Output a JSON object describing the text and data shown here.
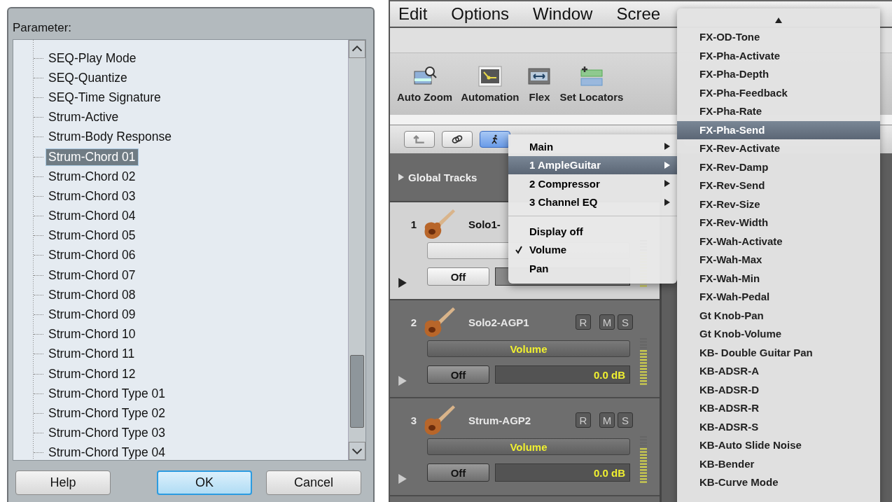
{
  "dialog": {
    "label": "Parameter:",
    "items": [
      {
        "text": "SEQ-Play Mode",
        "selected": false
      },
      {
        "text": "SEQ-Quantize",
        "selected": false
      },
      {
        "text": "SEQ-Time Signature",
        "selected": false
      },
      {
        "text": "Strum-Active",
        "selected": false
      },
      {
        "text": "Strum-Body Response",
        "selected": false
      },
      {
        "text": "Strum-Chord 01",
        "selected": true
      },
      {
        "text": "Strum-Chord 02",
        "selected": false
      },
      {
        "text": "Strum-Chord 03",
        "selected": false
      },
      {
        "text": "Strum-Chord 04",
        "selected": false
      },
      {
        "text": "Strum-Chord 05",
        "selected": false
      },
      {
        "text": "Strum-Chord 06",
        "selected": false
      },
      {
        "text": "Strum-Chord 07",
        "selected": false
      },
      {
        "text": "Strum-Chord 08",
        "selected": false
      },
      {
        "text": "Strum-Chord 09",
        "selected": false
      },
      {
        "text": "Strum-Chord 10",
        "selected": false
      },
      {
        "text": "Strum-Chord 11",
        "selected": false
      },
      {
        "text": "Strum-Chord 12",
        "selected": false
      },
      {
        "text": "Strum-Chord Type 01",
        "selected": false
      },
      {
        "text": "Strum-Chord Type 02",
        "selected": false
      },
      {
        "text": "Strum-Chord Type 03",
        "selected": false
      },
      {
        "text": "Strum-Chord Type 04",
        "selected": false
      }
    ],
    "buttons": [
      {
        "label": "Help",
        "default": false
      },
      {
        "label": "OK",
        "default": true
      },
      {
        "label": "Cancel",
        "default": false
      }
    ]
  },
  "app": {
    "menu_bar": [
      "Edit",
      "Options",
      "Window",
      "Scree"
    ],
    "toolbar": [
      {
        "label": "Auto Zoom",
        "kind": "zoom"
      },
      {
        "label": "Automation",
        "kind": "automation"
      },
      {
        "label": "Flex",
        "kind": "flex"
      },
      {
        "label": "Set Locators",
        "kind": "locators"
      }
    ],
    "global_tracks": "Global Tracks",
    "tracks": [
      {
        "number": "1",
        "name": "Solo1-",
        "selected": true,
        "off": "Off"
      },
      {
        "number": "2",
        "name": "Solo2-AGP1",
        "selected": false,
        "buttons": [
          "R",
          "M",
          "S"
        ],
        "param": "Volume",
        "off": "Off",
        "value": "0.0 dB"
      },
      {
        "number": "3",
        "name": "Strum-AGP2",
        "selected": false,
        "buttons": [
          "R",
          "M",
          "S"
        ],
        "param": "Volume",
        "off": "Off",
        "value": "0.0 dB"
      }
    ]
  },
  "context_menu": {
    "sections": [
      {
        "items": [
          {
            "label": "Main",
            "kind": "submenu",
            "selected": false,
            "checked": false
          },
          {
            "label": "1 AmpleGuitar",
            "kind": "submenu",
            "selected": true,
            "checked": false
          },
          {
            "label": "2 Compressor",
            "kind": "submenu",
            "selected": false,
            "checked": false
          },
          {
            "label": "3 Channel EQ",
            "kind": "submenu",
            "selected": false,
            "checked": false
          }
        ]
      },
      {
        "items": [
          {
            "label": "Display off",
            "kind": "option",
            "selected": false,
            "checked": false
          },
          {
            "label": "Volume",
            "kind": "option",
            "selected": false,
            "checked": true
          },
          {
            "label": "Pan",
            "kind": "option",
            "selected": false,
            "checked": false
          }
        ]
      }
    ]
  },
  "parameter_list": {
    "items": [
      {
        "label": "FX-OD-Tone",
        "selected": false
      },
      {
        "label": "FX-Pha-Activate",
        "selected": false
      },
      {
        "label": "FX-Pha-Depth",
        "selected": false
      },
      {
        "label": "FX-Pha-Feedback",
        "selected": false
      },
      {
        "label": "FX-Pha-Rate",
        "selected": false
      },
      {
        "label": "FX-Pha-Send",
        "selected": true
      },
      {
        "label": "FX-Rev-Activate",
        "selected": false
      },
      {
        "label": "FX-Rev-Damp",
        "selected": false
      },
      {
        "label": "FX-Rev-Send",
        "selected": false
      },
      {
        "label": "FX-Rev-Size",
        "selected": false
      },
      {
        "label": "FX-Rev-Width",
        "selected": false
      },
      {
        "label": "FX-Wah-Activate",
        "selected": false
      },
      {
        "label": "FX-Wah-Max",
        "selected": false
      },
      {
        "label": "FX-Wah-Min",
        "selected": false
      },
      {
        "label": "FX-Wah-Pedal",
        "selected": false
      },
      {
        "label": "Gt Knob-Pan",
        "selected": false
      },
      {
        "label": "Gt Knob-Volume",
        "selected": false
      },
      {
        "label": "KB- Double Guitar Pan",
        "selected": false
      },
      {
        "label": "KB-ADSR-A",
        "selected": false
      },
      {
        "label": "KB-ADSR-D",
        "selected": false
      },
      {
        "label": "KB-ADSR-R",
        "selected": false
      },
      {
        "label": "KB-ADSR-S",
        "selected": false
      },
      {
        "label": "KB-Auto Slide Noise",
        "selected": false
      },
      {
        "label": "KB-Bender",
        "selected": false
      },
      {
        "label": "KB-Curve Mode",
        "selected": false
      }
    ]
  }
}
